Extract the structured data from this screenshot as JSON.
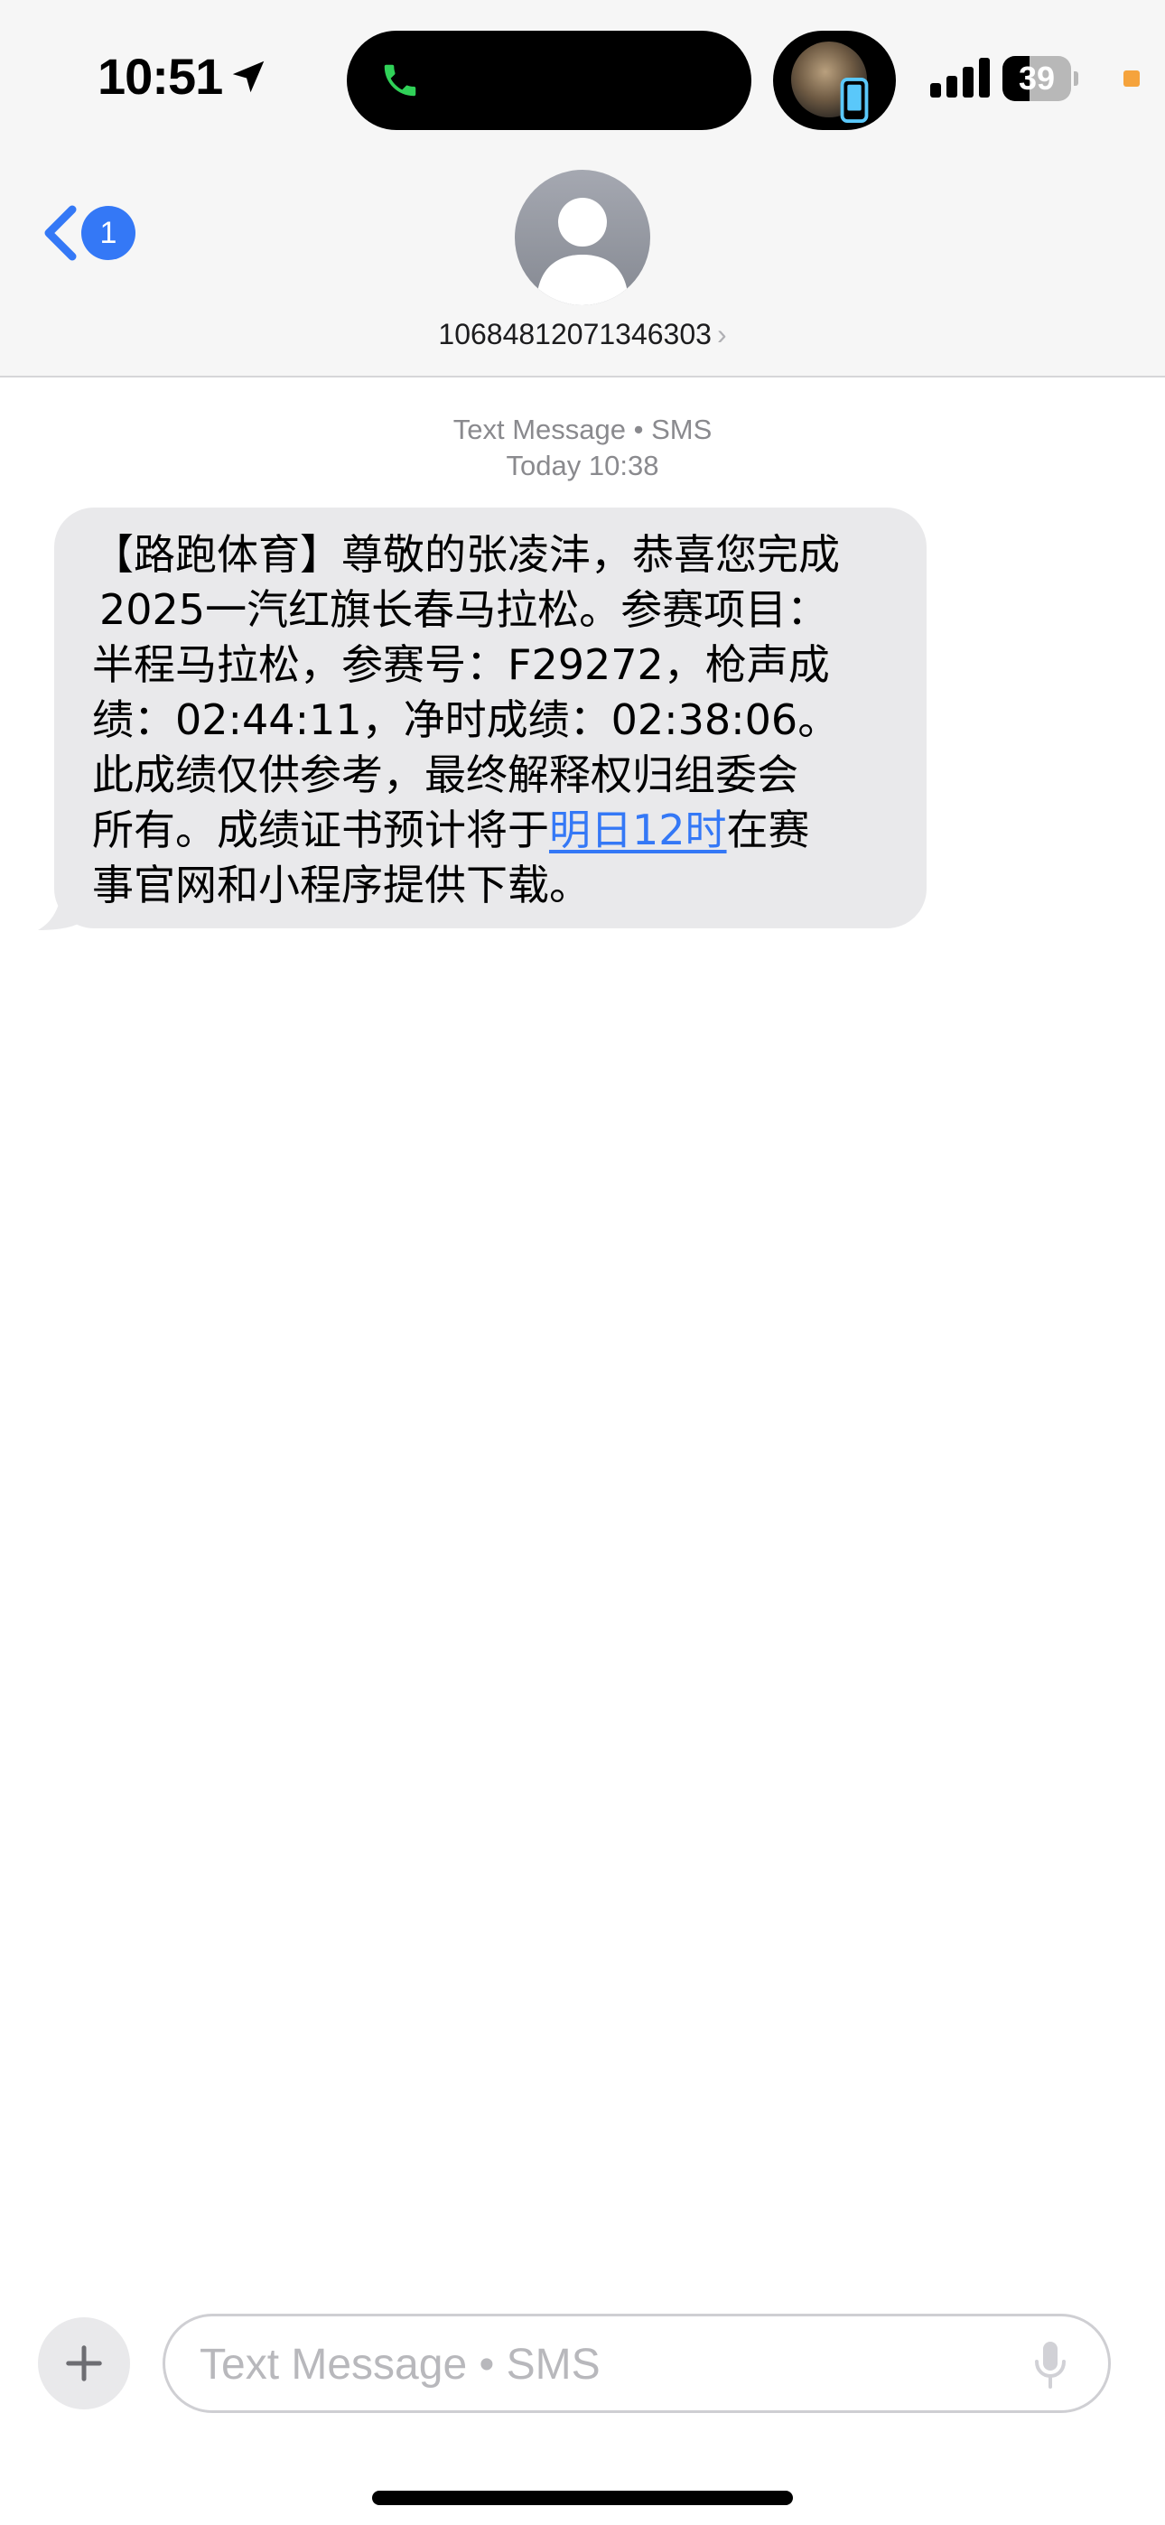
{
  "status_bar": {
    "time": "10:51",
    "battery_level": "39",
    "battery_fraction": 0.39,
    "icons": [
      "location-arrow-icon",
      "phone-call-icon",
      "cellular-signal-icon",
      "battery-icon"
    ]
  },
  "header": {
    "back_badge": "1",
    "contact_name": "10684812071346303",
    "chevron": "›"
  },
  "conversation": {
    "service_label": "Text Message • SMS",
    "timestamp": "Today 10:38",
    "message": {
      "lines": [
        "【路跑体育】尊敬的张凌沣，恭喜您完成",
        "2025一汽红旗长春马拉松。参赛项目：",
        "半程马拉松，参赛号：F29272，枪声成",
        "绩：02:44:11，净时成绩：02:38:06。",
        "此成绩仅供参考，最终解释权归组委会"
      ],
      "line6_prefix": "所有。成绩证书预计将于",
      "line6_link": "明日12时",
      "line6_suffix": "在赛",
      "line7": "事官网和小程序提供下载。"
    }
  },
  "composer": {
    "placeholder": "Text Message • SMS"
  },
  "colors": {
    "accent": "#3478f6",
    "bubble_received": "#e9e9eb",
    "header_bg": "#f6f6f6",
    "meta_text": "#8a8a8e"
  }
}
